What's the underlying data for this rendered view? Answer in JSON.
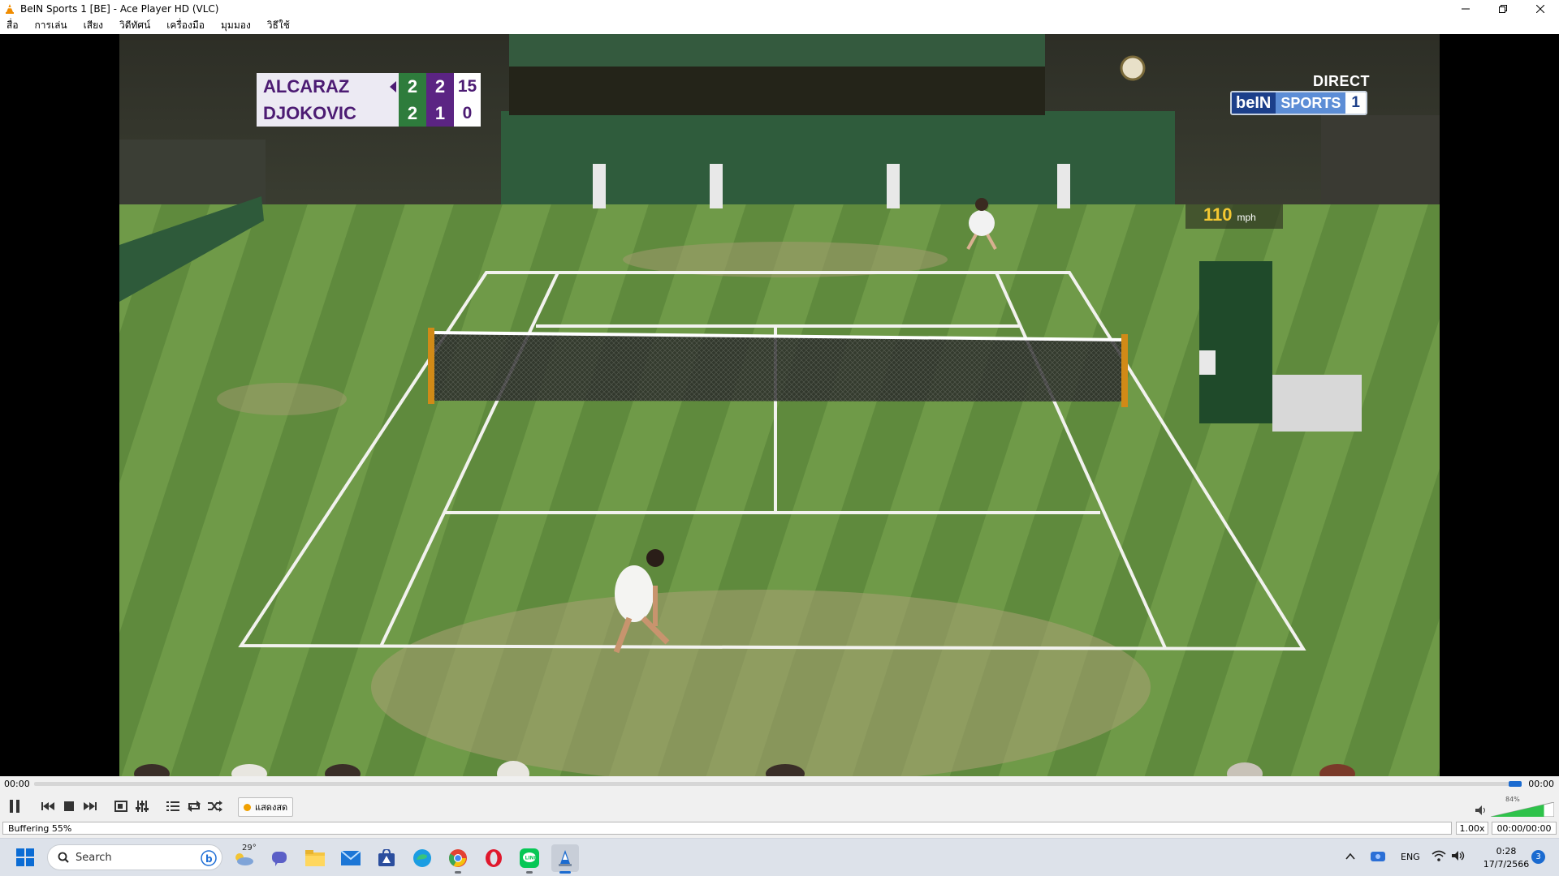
{
  "window": {
    "title": "BeIN Sports 1 [BE] - Ace Player HD (VLC)",
    "controls": [
      "minimize",
      "maximize",
      "close"
    ]
  },
  "menu": [
    "สื่อ",
    "การเล่น",
    "เสียง",
    "วิดีทัศน์",
    "เครื่องมือ",
    "มุมมอง",
    "วิธีใช้"
  ],
  "video": {
    "scoreboard": {
      "players": [
        {
          "name": "ALCARAZ",
          "set1": "2",
          "set2": "2",
          "points": "15",
          "serving": true
        },
        {
          "name": "DJOKOVIC",
          "set1": "2",
          "set2": "1",
          "points": "0",
          "serving": false
        }
      ]
    },
    "broadcaster": {
      "direct": "DIRECT",
      "logo_left": "beIN",
      "logo_mid": "SPORTS",
      "logo_num": "1"
    },
    "serve_speed": {
      "value": "110",
      "unit": "mph"
    }
  },
  "seek": {
    "elapsed": "00:00",
    "total": "00:00",
    "position_fraction": 1.0
  },
  "controls": {
    "live_label": "แสดงสด",
    "volume_percent": "84%",
    "volume_level": 0.84
  },
  "status": {
    "text": "Buffering 55%",
    "rate": "1.00x",
    "time_counter": "00:00/00:00"
  },
  "taskbar": {
    "search_placeholder": "Search",
    "weather": "29°",
    "language": "ENG",
    "time": "0:28",
    "date": "17/7/2566",
    "notification_count": "3"
  },
  "colors": {
    "vlc_orange": "#f08c00",
    "bein_blue": "#1c3f8a",
    "wimbledon_green": "#2e7c3c",
    "wimbledon_purple": "#5b2483",
    "seek_blue": "#1b6bd0"
  }
}
